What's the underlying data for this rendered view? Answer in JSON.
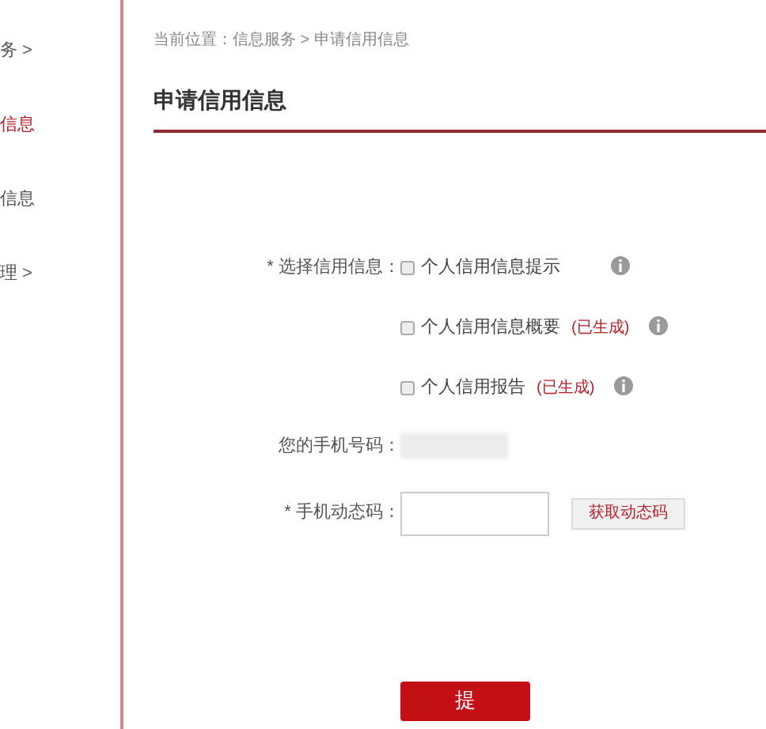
{
  "sidebar": {
    "items": [
      {
        "label": "务 >",
        "selected": false
      },
      {
        "label": "信息",
        "selected": true
      },
      {
        "label": "信息",
        "selected": false
      },
      {
        "label": "理 >",
        "selected": false
      }
    ]
  },
  "breadcrumb": "当前位置：信息服务 > 申请信用信息",
  "title": "申请信用信息",
  "form": {
    "credit_label": "* 选择信用信息：",
    "options": [
      {
        "label": "个人信用信息提示",
        "checked": false
      },
      {
        "label": "个人信用信息概要",
        "checked": false,
        "note": "(已生成)"
      },
      {
        "label": "个人信用报告",
        "checked": false,
        "note": "(已生成)"
      }
    ],
    "phone_label": "您的手机号码：",
    "code_label": "* 手机动态码：",
    "code_button": "获取动态码",
    "submit": "提"
  }
}
